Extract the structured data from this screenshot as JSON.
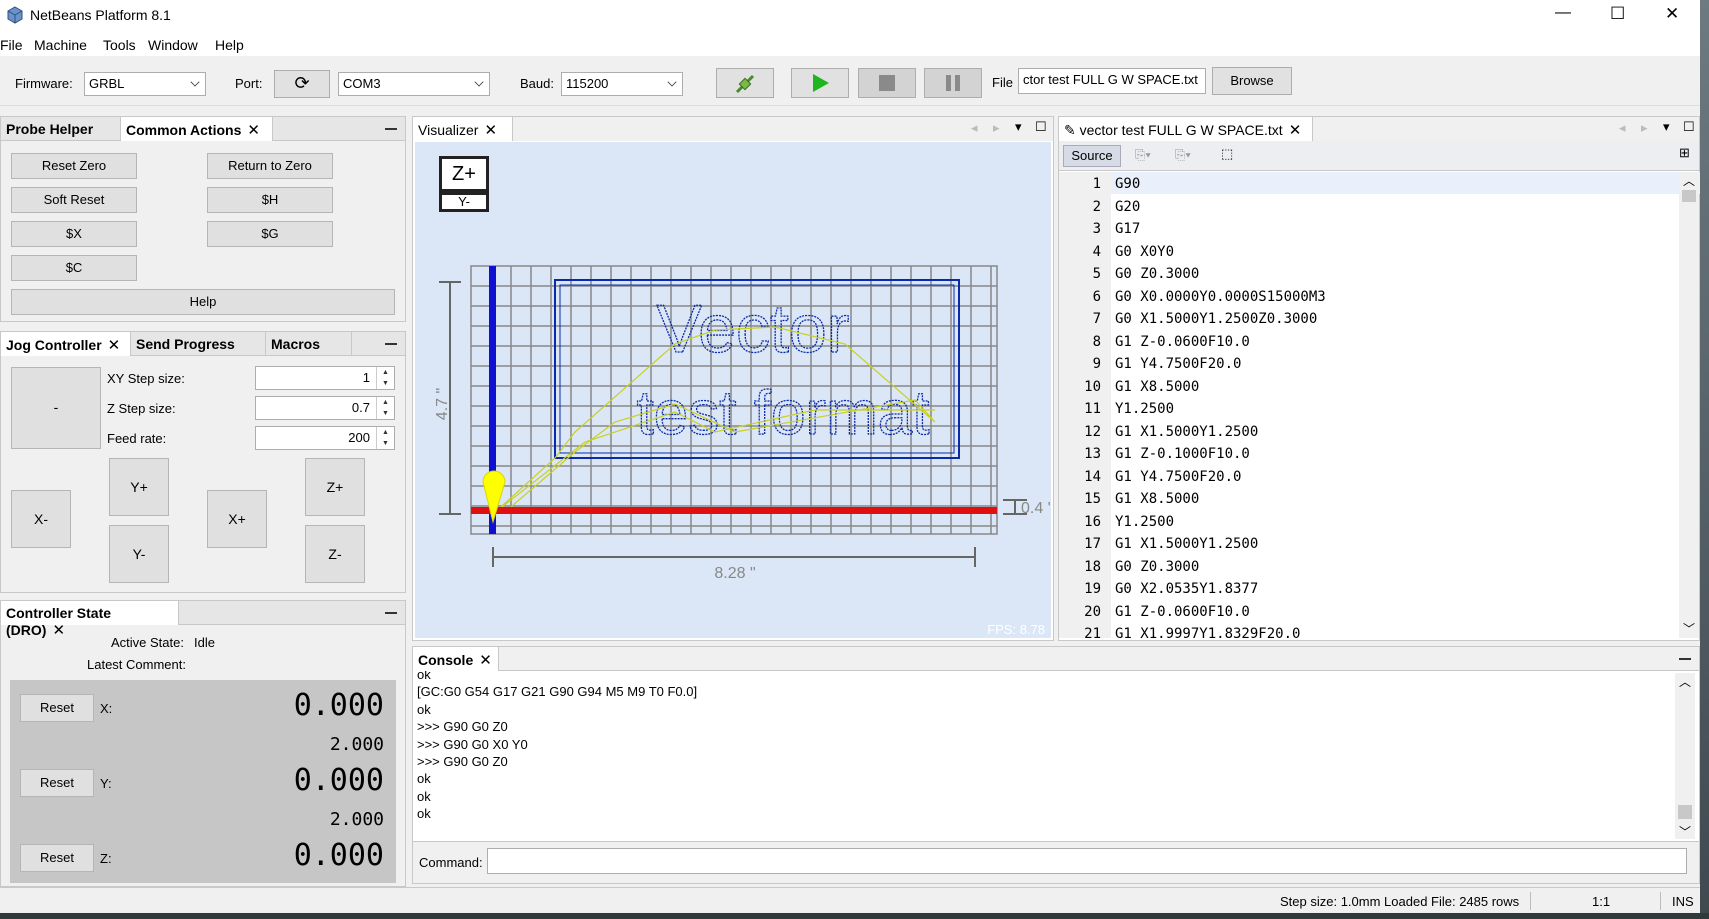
{
  "window": {
    "title": "NetBeans Platform 8.1",
    "minimize": "—",
    "maximize": "☐",
    "close": "✕"
  },
  "menu": [
    "File",
    "Machine",
    "Tools",
    "Window",
    "Help"
  ],
  "toolbar": {
    "firmware_label": "Firmware:",
    "firmware_value": "GRBL",
    "port_label": "Port:",
    "port_value": "COM3",
    "baud_label": "Baud:",
    "baud_value": "115200",
    "file_label": "File",
    "file_value": "ctor test FULL G W SPACE.txt",
    "browse": "Browse"
  },
  "common_actions": {
    "tabs": [
      "Probe Helper",
      "Common Actions"
    ],
    "buttons": [
      "Reset Zero",
      "Return to Zero",
      "Soft Reset",
      "$H",
      "$X",
      "$G",
      "$C"
    ],
    "help": "Help"
  },
  "jog": {
    "tabs": [
      "Jog Controller",
      "Send Progress",
      "Macros"
    ],
    "center": "-",
    "xy_label": "XY Step size:",
    "xy_value": "1",
    "z_label": "Z Step size:",
    "z_value": "0.7",
    "feed_label": "Feed rate:",
    "feed_value": "200",
    "buttons": {
      "yplus": "Y+",
      "yminus": "Y-",
      "xminus": "X-",
      "xplus": "X+",
      "zplus": "Z+",
      "zminus": "Z-"
    }
  },
  "dro": {
    "title": "Controller State (DRO)",
    "active_label": "Active State:",
    "active_value": "Idle",
    "comment_label": "Latest Comment:",
    "reset": "Reset",
    "axes": [
      {
        "label": "X:",
        "value": "0.000",
        "sub": "2.000"
      },
      {
        "label": "Y:",
        "value": "0.000",
        "sub": "2.000"
      },
      {
        "label": "Z:",
        "value": "0.000"
      }
    ]
  },
  "visualizer": {
    "tab": "Visualizer",
    "z_plus": "Z+",
    "y_minus": "Y-",
    "width_label": "8.28 \"",
    "height_label": "4.7 \"",
    "z_label": "0.4 \"",
    "art_line1": "Vector",
    "art_line2": "test format",
    "fps": "FPS: 8.78"
  },
  "editor": {
    "tab": "vector test FULL G W SPACE.txt",
    "source": "Source",
    "lines": [
      "G90",
      "G20",
      "G17",
      "G0 X0Y0",
      "G0 Z0.3000",
      "G0 X0.0000Y0.0000S15000M3",
      "G0 X1.5000Y1.2500Z0.3000",
      "G1 Z-0.0600F10.0",
      "G1 Y4.7500F20.0",
      "G1 X8.5000",
      "Y1.2500",
      "G1 X1.5000Y1.2500",
      "G1 Z-0.1000F10.0",
      "G1 Y4.7500F20.0",
      "G1 X8.5000",
      "Y1.2500",
      "G1 X1.5000Y1.2500",
      "G0 Z0.3000",
      "G0 X2.0535Y1.8377",
      "G1 Z-0.0600F10.0",
      "G1 X1.9997Y1.8329F20.0"
    ]
  },
  "console": {
    "tab": "Console",
    "lines": [
      "ok",
      "[GC:G0 G54 G17 G21 G90 G94 M5 M9 T0 F0.0]",
      "ok",
      ">>> G90 G0 Z0",
      ">>> G90 G0 X0 Y0",
      ">>> G90 G0 Z0",
      "ok",
      "ok",
      "ok"
    ],
    "command_label": "Command:"
  },
  "status": {
    "text": "Step size: 1.0mm Loaded File: 2485 rows",
    "ratio": "1:1",
    "mode": "INS"
  },
  "colors": {
    "grid_bg": "#dbe7f6",
    "toolpath": "#0a2aa8",
    "x_axis": "#e01010",
    "y_axis": "#1010d0",
    "rapid": "#c8d020",
    "tool": "#ffff00"
  }
}
